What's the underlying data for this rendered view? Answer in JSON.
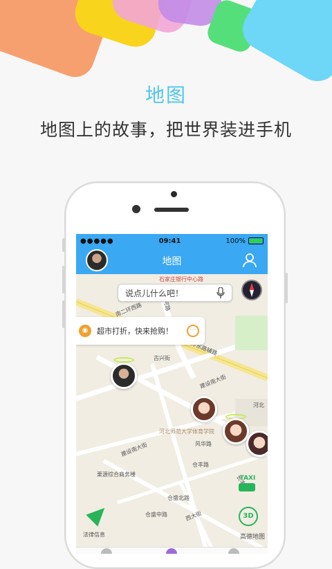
{
  "hero": {
    "title": "地图",
    "subtitle": "地图上的故事，把世界装进手机"
  },
  "status_bar": {
    "carrier": "●●●●● ",
    "time": "09:41",
    "battery": "100%",
    "battery_level": 1.0
  },
  "nav_bar": {
    "title": "地图"
  },
  "search": {
    "placeholder": "说点儿什么吧！"
  },
  "bubble": {
    "text": "超市打折，快来抢购！"
  },
  "map_labels": {
    "road1": "南二环西路",
    "road2": "金河路",
    "road3": "环东路辅路",
    "road4": "建设南大街",
    "road5": "古兴街",
    "poi1": "河北师范大学体育学院",
    "road6": "风华路",
    "road7": "仓丰路",
    "road8": "建设南大街",
    "poi2": "栗源综合商务楼",
    "road9": "仓盛北路",
    "road10": "仓盛中路",
    "road11": "西大街",
    "road12": "长丰路",
    "poi3": "河北",
    "top_poi": "石家庄银行中心路"
  },
  "controls": {
    "taxi": "TAXI",
    "three_d": "3D",
    "legal": "法律信息",
    "amap": "高德地图"
  },
  "colors": {
    "accent": "#3aa8f2",
    "hero_title": "#52c6ea",
    "map_green": "#28b45a",
    "bubble_orange": "#f0a030"
  }
}
